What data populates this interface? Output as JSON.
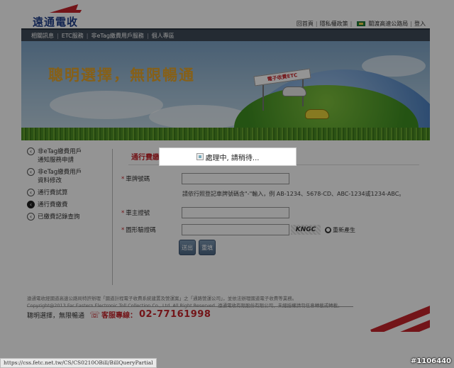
{
  "header": {
    "logo_text": "遠通電收",
    "links": [
      "回首頁",
      "隱私權政策",
      "關渡高速公路局",
      "登入"
    ]
  },
  "nav": {
    "items": [
      "相關訊息",
      "ETC服務",
      "非eTag繳費用戶服務",
      "個人專區"
    ]
  },
  "banner": {
    "slogan": "聰明選擇，無限暢通",
    "sign_text": "電子收費ETC"
  },
  "sidebar": {
    "items": [
      {
        "line1": "非eTag繳費用戶",
        "line2": "通知服務申請",
        "active": false
      },
      {
        "line1": "非eTag繳費用戶",
        "line2": "資料修改",
        "active": false
      },
      {
        "line1": "通行費試算",
        "line2": "",
        "active": false
      },
      {
        "line1": "通行費繳費",
        "line2": "",
        "active": true
      },
      {
        "line1": "已繳費記錄查詢",
        "line2": "",
        "active": false
      }
    ]
  },
  "form": {
    "section_title": "通行費繳",
    "plate_label": "車牌號碼",
    "plate_value": "",
    "plate_hint": "請依行照登記車牌號碼含\"-\"輸入，例 AB-1234、5678-CD、ABC-1234或1234-ABC。",
    "owner_id_label": "車主證號",
    "owner_id_value": "",
    "captcha_label": "圖形驗證碼",
    "captcha_value": "",
    "captcha_image_text": "KNGC",
    "refresh_label": "重新產生",
    "submit_label": "送出",
    "reset_label": "重填"
  },
  "footer": {
    "line1": "遠通電收經國道高速公路局特許辦理「國道計程電子收費系統建置及營運案」之「通路營運公司」，並依法辦理國道電子收費等業務。",
    "line2": "Copyright@2013 Far Eastern Electronic Toll Collection Co., Ltd. All Right Reserved. 遠通電收有限股份有限公司，未經授權請勿任意轉載或轉載。",
    "slogan": "聰明選擇，無限暢通",
    "service_label": "客服專線：",
    "service_number": "02-77161998"
  },
  "loading": {
    "message": "處理中, 請稍待..."
  },
  "statusbar": {
    "url": "https://css.fetc.net.tw/CS/CS0210OBill/BillQueryPartial"
  },
  "watermark": "#1106440",
  "colors": {
    "brand_red": "#c7252b",
    "brand_blue": "#1f3f8a",
    "nav_bg": "#3f4a58",
    "slogan_gold": "#e7a62a"
  }
}
